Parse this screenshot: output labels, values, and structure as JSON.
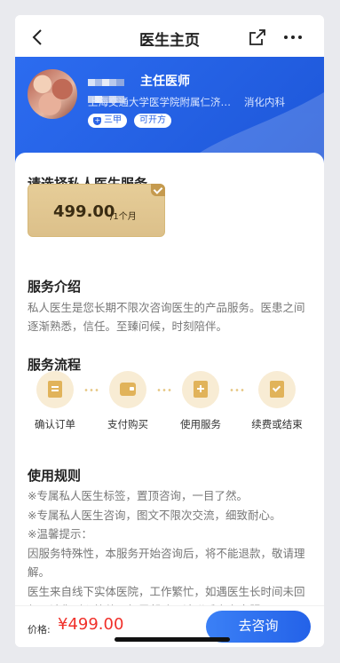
{
  "nav": {
    "title": "医生主页",
    "back_icon": "back-chevron-icon",
    "share_icon": "share-icon",
    "more_icon": "more-icon"
  },
  "doctor": {
    "title": "主任医师",
    "hospital": "上海交通大学医学院附属仁济…",
    "department": "消化内科",
    "tags": [
      "三甲",
      "可开方"
    ],
    "header_color": "#2a64e6"
  },
  "service": {
    "section_title": "请选择私人医生服务",
    "price": "499.00",
    "unit": "/1个月"
  },
  "intro": {
    "title": "服务介绍",
    "text": "私人医生是您长期不限次咨询医生的产品服务。医患之间逐渐熟悉，信任。至臻问候，时刻陪伴。"
  },
  "process": {
    "title": "服务流程",
    "steps": [
      {
        "label": "确认订单",
        "icon": "order-doc-icon"
      },
      {
        "label": "支付购买",
        "icon": "wallet-icon"
      },
      {
        "label": "使用服务",
        "icon": "add-doc-icon"
      },
      {
        "label": "续费或结束",
        "icon": "check-doc-icon"
      }
    ]
  },
  "rules": {
    "title": "使用规则",
    "lines": [
      "※专属私人医生标签，置顶咨询，一目了然。",
      "※专属私人医生咨询，图文不限次交流，细致耐心。",
      "※温馨提示：",
      "因服务特殊性，本服务开始咨询后，将不能退款，敬请理解。",
      "医生来自线下实体医院，工作繁忙，如遇医生长时间未回复，请您耐心等待，如需帮助，请联系京东客服。"
    ]
  },
  "bottom": {
    "price_label": "价格:",
    "price_total": "¥499.00",
    "consult_label": "去咨询",
    "price_color": "#f0302a"
  }
}
